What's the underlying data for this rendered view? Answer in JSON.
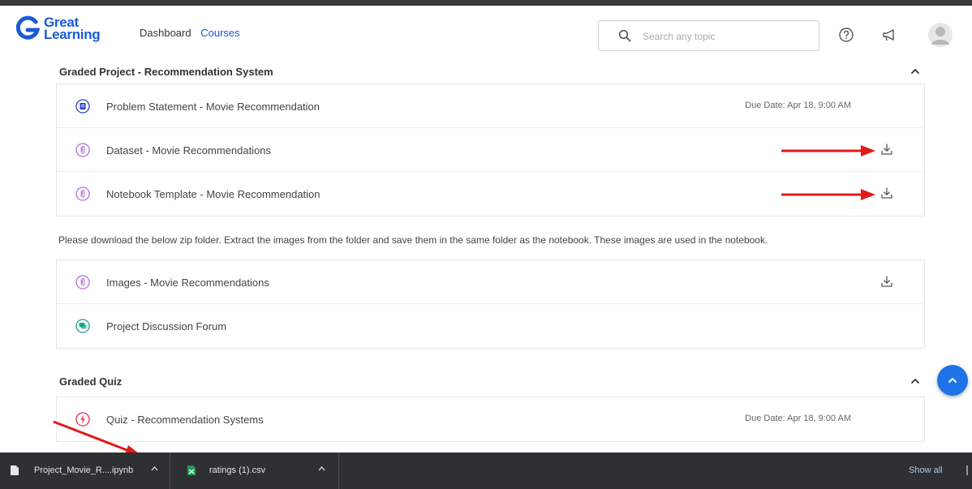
{
  "header": {
    "logo_line1": "Great",
    "logo_line2": "Learning",
    "nav": {
      "dashboard": "Dashboard",
      "courses": "Courses"
    },
    "search_placeholder": "Search any topic"
  },
  "sections": [
    {
      "title": "Graded Project - Recommendation System",
      "items": [
        {
          "label": "Problem Statement - Movie Recommendation",
          "icon": "document-icon",
          "due": "Due Date: Apr 18, 9:00 AM"
        },
        {
          "label": "Dataset - Movie Recommendations",
          "icon": "attachment-icon"
        },
        {
          "label": "Notebook Template - Movie Recommendation",
          "icon": "attachment-icon"
        }
      ],
      "note": "Please download the below zip folder. Extract the images from the folder and save them in the same folder as the notebook. These images are used in the notebook.",
      "items2": [
        {
          "label": "Images - Movie Recommendations",
          "icon": "attachment-icon"
        },
        {
          "label": "Project Discussion Forum",
          "icon": "forum-icon"
        }
      ]
    },
    {
      "title": "Graded Quiz",
      "items": [
        {
          "label": "Quiz - Recommendation Systems",
          "icon": "quiz-icon",
          "due": "Due Date: Apr 18, 9:00 AM"
        }
      ]
    }
  ],
  "downloads": {
    "files": [
      {
        "name": "Project_Movie_R....ipynb"
      },
      {
        "name": "ratings (1).csv"
      }
    ],
    "show_all": "Show all"
  },
  "colors": {
    "accent": "#1a5ad7",
    "attachment": "#b070d8",
    "document": "#2c3fc2",
    "forum": "#19a58a",
    "quiz": "#e0334e",
    "annotation": "#e11a1a",
    "download_bar": "#2f3033"
  }
}
